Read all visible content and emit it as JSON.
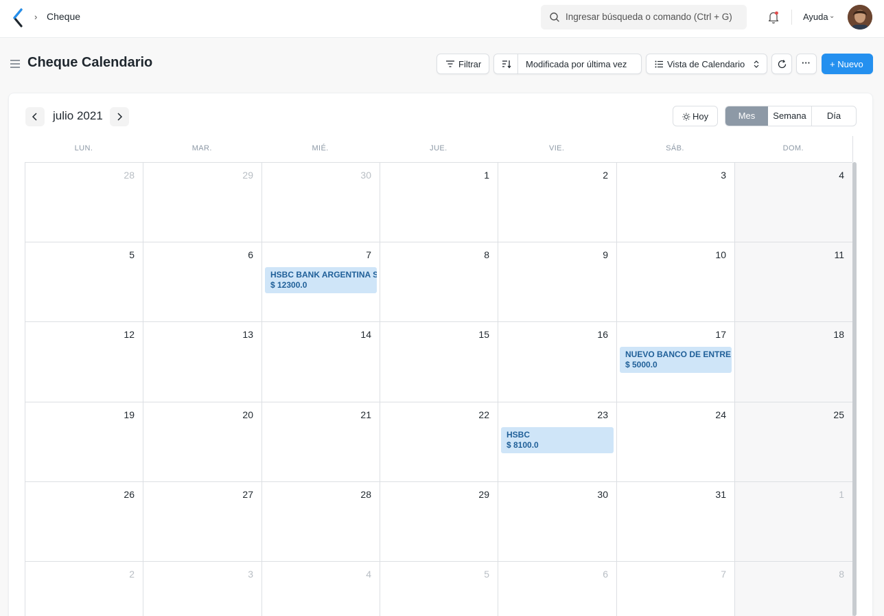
{
  "navbar": {
    "breadcrumb": "Cheque",
    "search_placeholder": "Ingresar búsqueda o comando (Ctrl + G)",
    "help_label": "Ayuda"
  },
  "page": {
    "title": "Cheque Calendario",
    "filter_label": "Filtrar",
    "sort_label": "Modificada por última vez",
    "view_label": "Vista de Calendario",
    "more_label": "···",
    "new_label": "+ Nuevo"
  },
  "calendar": {
    "month_title": "julio 2021",
    "today_label": "Hoy",
    "views": [
      "Mes",
      "Semana",
      "Día"
    ],
    "active_view": "Mes",
    "weekdays": [
      "LUN.",
      "MAR.",
      "MIÉ.",
      "JUE.",
      "VIE.",
      "SÁB.",
      "DOM."
    ],
    "weeks": [
      [
        {
          "d": "28",
          "m": true
        },
        {
          "d": "29",
          "m": true
        },
        {
          "d": "30",
          "m": true
        },
        {
          "d": "1"
        },
        {
          "d": "2"
        },
        {
          "d": "3"
        },
        {
          "d": "4"
        }
      ],
      [
        {
          "d": "5"
        },
        {
          "d": "6"
        },
        {
          "d": "7",
          "event": {
            "title": "HSBC BANK ARGENTINA S",
            "amount": "$ 12300.0"
          }
        },
        {
          "d": "8"
        },
        {
          "d": "9"
        },
        {
          "d": "10"
        },
        {
          "d": "11"
        }
      ],
      [
        {
          "d": "12"
        },
        {
          "d": "13"
        },
        {
          "d": "14"
        },
        {
          "d": "15"
        },
        {
          "d": "16"
        },
        {
          "d": "17",
          "event": {
            "title": "NUEVO BANCO DE ENTRE",
            "amount": "$ 5000.0"
          }
        },
        {
          "d": "18"
        }
      ],
      [
        {
          "d": "19"
        },
        {
          "d": "20"
        },
        {
          "d": "21"
        },
        {
          "d": "22"
        },
        {
          "d": "23",
          "event": {
            "title": "HSBC",
            "amount": "$ 8100.0"
          }
        },
        {
          "d": "24"
        },
        {
          "d": "25"
        }
      ],
      [
        {
          "d": "26"
        },
        {
          "d": "27"
        },
        {
          "d": "28"
        },
        {
          "d": "29"
        },
        {
          "d": "30"
        },
        {
          "d": "31"
        },
        {
          "d": "1",
          "m": true
        }
      ],
      [
        {
          "d": "2",
          "m": true
        },
        {
          "d": "3",
          "m": true
        },
        {
          "d": "4",
          "m": true
        },
        {
          "d": "5",
          "m": true
        },
        {
          "d": "6",
          "m": true
        },
        {
          "d": "7",
          "m": true
        },
        {
          "d": "8",
          "m": true
        }
      ]
    ]
  },
  "colors": {
    "primary": "#2490ef",
    "event_bg": "#cfe5f8",
    "event_text": "#1f5f98",
    "active_view": "#8d99a6"
  }
}
